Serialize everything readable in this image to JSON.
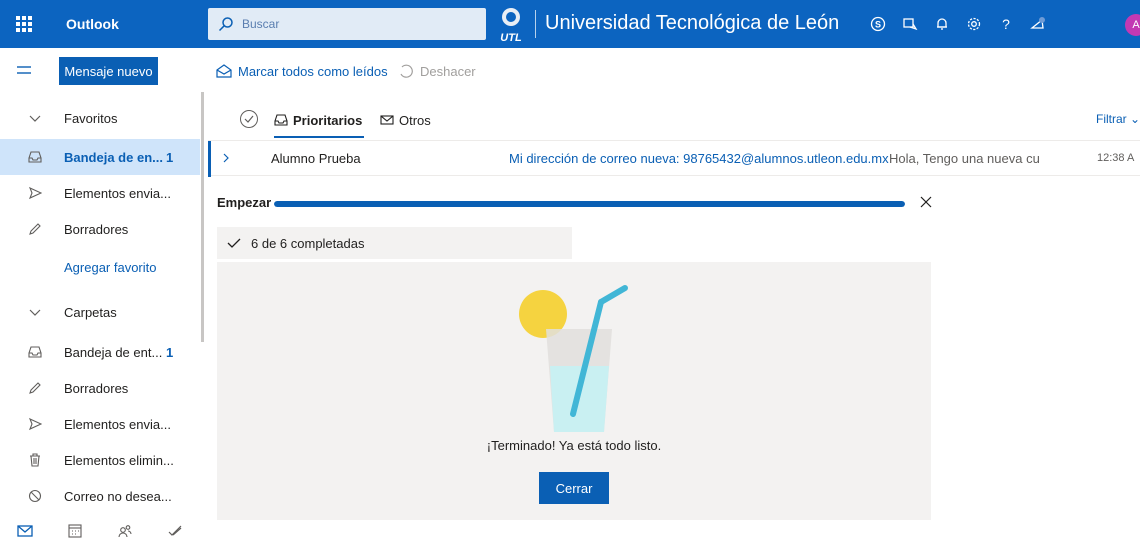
{
  "topbar": {
    "app_name": "Outlook",
    "search_placeholder": "Buscar",
    "org_name": "Universidad Tecnológica de León",
    "logo_text": "UTL",
    "avatar_initial": "A",
    "icons": [
      "skype-icon",
      "teams-icon",
      "bell-icon",
      "gear-icon",
      "help-icon",
      "whats-new-icon"
    ],
    "brand_color": "#0c64c0"
  },
  "command_bar": {
    "new_mail_label": "Mensaje nuevo",
    "mark_all_read_label": "Marcar todos como leídos",
    "undo_label": "Deshacer"
  },
  "nav": {
    "favorites_header": "Favoritos",
    "favorites": [
      {
        "label": "Bandeja de en...",
        "count": "1",
        "icon": "inbox-icon"
      },
      {
        "label": "Elementos envia...",
        "count": "",
        "icon": "send-icon"
      },
      {
        "label": "Borradores",
        "count": "",
        "icon": "pencil-icon"
      }
    ],
    "add_favorite_label": "Agregar favorito",
    "folders_header": "Carpetas",
    "folders": [
      {
        "label": "Bandeja de ent...",
        "count": "1",
        "icon": "inbox-icon"
      },
      {
        "label": "Borradores",
        "count": "",
        "icon": "pencil-icon"
      },
      {
        "label": "Elementos envia...",
        "count": "",
        "icon": "send-icon"
      },
      {
        "label": "Elementos elimin...",
        "count": "",
        "icon": "trash-icon"
      },
      {
        "label": "Correo no desea...",
        "count": "",
        "icon": "block-icon"
      }
    ],
    "bottom_icons": [
      "mail-icon",
      "calendar-icon",
      "people-icon",
      "todo-icon"
    ]
  },
  "message_list": {
    "tab_focused": "Prioritarios",
    "tab_other": "Otros",
    "filter_label": "Filtrar",
    "message": {
      "from": "Alumno Prueba",
      "subject": "Mi dirección de correo nueva: 98765432@alumnos.utleon.edu.mx",
      "preview": "Hola, Tengo una nueva cuent...",
      "time": "12:38 A"
    }
  },
  "getting_started": {
    "title": "Empezar",
    "progress": 1.0,
    "completed_label": "6 de 6 completadas",
    "done_message": "¡Terminado! Ya está todo listo.",
    "close_button_label": "Cerrar"
  }
}
